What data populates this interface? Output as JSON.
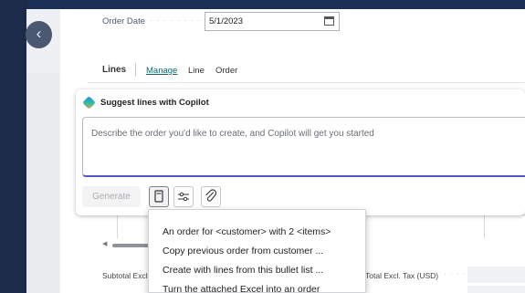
{
  "order_date": {
    "label": "Order Date",
    "dots": "· · · · · · · · · · · ·",
    "value": "5/1/2023"
  },
  "lines_bar": {
    "title": "Lines",
    "links": [
      "Manage",
      "Line",
      "Order"
    ]
  },
  "copilot": {
    "title": "Suggest lines with Copilot",
    "placeholder": "Describe the order you'd like to create, and Copilot will get you started",
    "generate_label": "Generate"
  },
  "prompt_menu": {
    "items": [
      "An order for <customer> with 2 <items>",
      "Copy previous order from customer ...",
      "Create with lines from this bullet list ...",
      "Turn the attached Excel into an order"
    ]
  },
  "totals": {
    "subtotal_label": "Subtotal Excl. Tax (USD)",
    "tax_label": "Total Excl. Tax (USD)",
    "tax_dots": "· · · ·"
  }
}
